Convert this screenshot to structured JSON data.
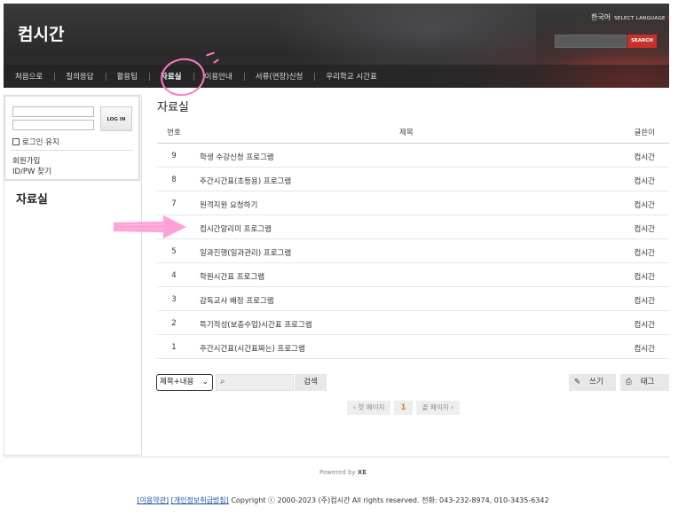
{
  "header": {
    "logo": "컴시간",
    "lang_current": "한국어",
    "lang_select": "SELECT LANGUAGE",
    "search_button": "SEARCH"
  },
  "nav": {
    "items": [
      "처음으로",
      "질의응답",
      "활용팁",
      "자료실",
      "이용안내",
      "서류(연장)신청",
      "우리학교 시간표"
    ],
    "active_index": 3
  },
  "login": {
    "button": "LOG IN",
    "keep_login": "로그인 유지",
    "signup": "회원가입",
    "find": "ID/PW 찾기"
  },
  "sidebar": {
    "title": "자료실"
  },
  "board": {
    "title": "자료실",
    "columns": {
      "num": "번호",
      "title": "제목",
      "author": "글쓴이"
    },
    "rows": [
      {
        "num": "9",
        "title": "학생 수강신청 프로그램",
        "author": "컴시간"
      },
      {
        "num": "8",
        "title": "주간시간표(초등용) 프로그램",
        "author": "컴시간"
      },
      {
        "num": "7",
        "title": "원격지원 요청하기",
        "author": "컴시간"
      },
      {
        "num": "",
        "title": "컴시간알리미 프로그램",
        "author": "컴시간"
      },
      {
        "num": "5",
        "title": "일과진행(일과관리) 프로그램",
        "author": "컴시간"
      },
      {
        "num": "4",
        "title": "학원시간표 프로그램",
        "author": "컴시간"
      },
      {
        "num": "3",
        "title": "감독교사 배정 프로그램",
        "author": "컴시간"
      },
      {
        "num": "2",
        "title": "특기적성(보충수업)시간표 프로그램",
        "author": "컴시간"
      },
      {
        "num": "1",
        "title": "주간시간표(시간표짜는) 프로그램",
        "author": "컴시간"
      }
    ],
    "search_select": "제목+내용",
    "search_button": "검색",
    "write_button": "쓰기",
    "tag_button": "태그",
    "pager": {
      "first": "‹ 첫 페이지",
      "current": "1",
      "last": "끝 페이지 ›"
    }
  },
  "footer": {
    "powered": "Powered by",
    "powered_brand": "XE",
    "terms": "[이용약관]",
    "privacy": "[개인정보취급방침]",
    "copyright": "Copyright ⓒ 2000-2023 (주)컴시간 All rights reserved. 전화: 043-232-8974, 010-3435-6342"
  },
  "colors": {
    "accent_red": "#c8312b",
    "annotation_pink": "#ff79c6",
    "pager_current": "#e07f12"
  }
}
